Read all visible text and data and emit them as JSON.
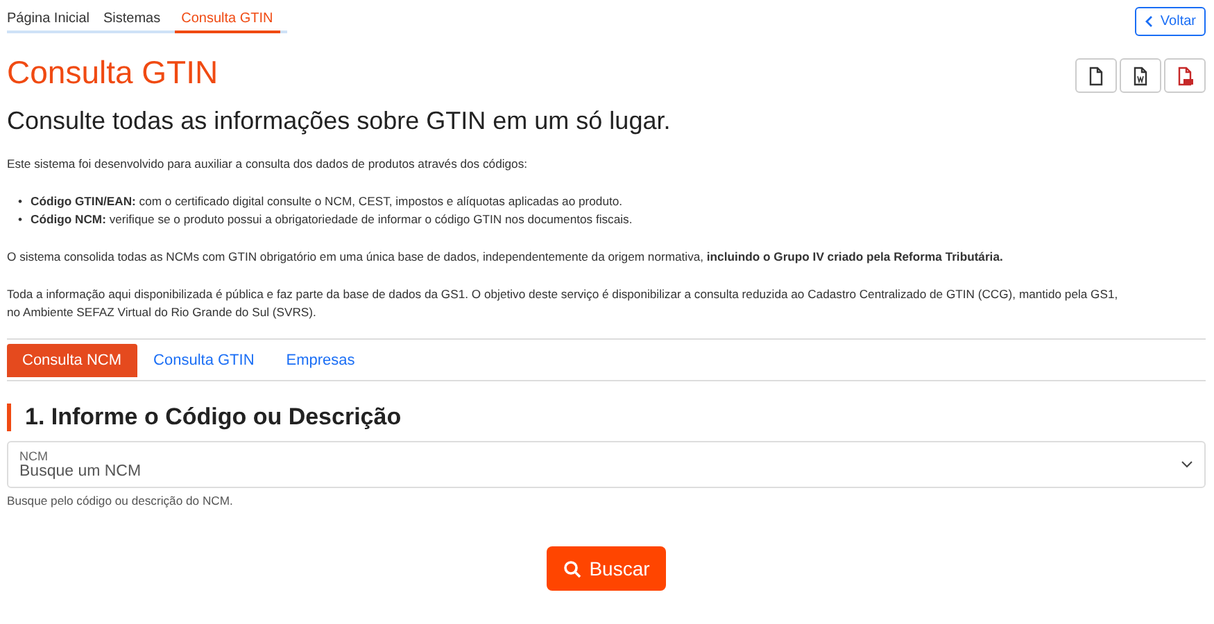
{
  "breadcrumb": [
    {
      "label": "Página Inicial",
      "selected": false
    },
    {
      "label": "Sistemas",
      "selected": false
    },
    {
      "label": "Consulta GTIN",
      "selected": true
    }
  ],
  "back_button": {
    "label": "Voltar"
  },
  "title": "Consulta GTIN",
  "export_buttons": [
    {
      "kind": "file"
    },
    {
      "kind": "word"
    },
    {
      "kind": "pdf"
    }
  ],
  "subtitle": "Consulte todas as informações sobre GTIN em um só lugar.",
  "intro": "Este sistema foi desenvolvido para auxiliar a consulta dos dados de produtos através dos códigos:",
  "bullets": [
    {
      "marker": "•",
      "text": "**Código GTIN/EAN:** com o certificado digital consulte o NCM, CEST, impostos e alíquotas aplicadas ao produto."
    },
    {
      "marker": "•",
      "text": "**Código NCM:** verifique se o produto possui a obrigatoriedade de informar o código GTIN nos documentos fiscais."
    }
  ],
  "paragraphs": [
    "O sistema consolida todas as NCMs com GTIN obrigatório em uma única base de dados, independentemente da origem normativa, **incluindo o Grupo IV criado pela Reforma Tributária.**",
    "Toda a informação aqui disponibilizada é pública e faz parte da base de dados da GS1. O objetivo deste serviço é disponibilizar a consulta reduzida ao Cadastro Centralizado de GTIN (CCG), mantido pela GS1, no Ambiente SEFAZ Virtual do Rio Grande do Sul (SVRS)."
  ],
  "tabs": [
    {
      "label": "Consulta NCM",
      "selected": true
    },
    {
      "label": "Consulta GTIN",
      "selected": false
    },
    {
      "label": "Empresas",
      "selected": false
    }
  ],
  "section_heading": "1. Informe o Código ou Descrição",
  "select": {
    "label": "NCM",
    "placeholder": "Busque um NCM",
    "help": "Busque pelo código ou descrição do NCM."
  },
  "search_button": {
    "label": "Buscar"
  }
}
